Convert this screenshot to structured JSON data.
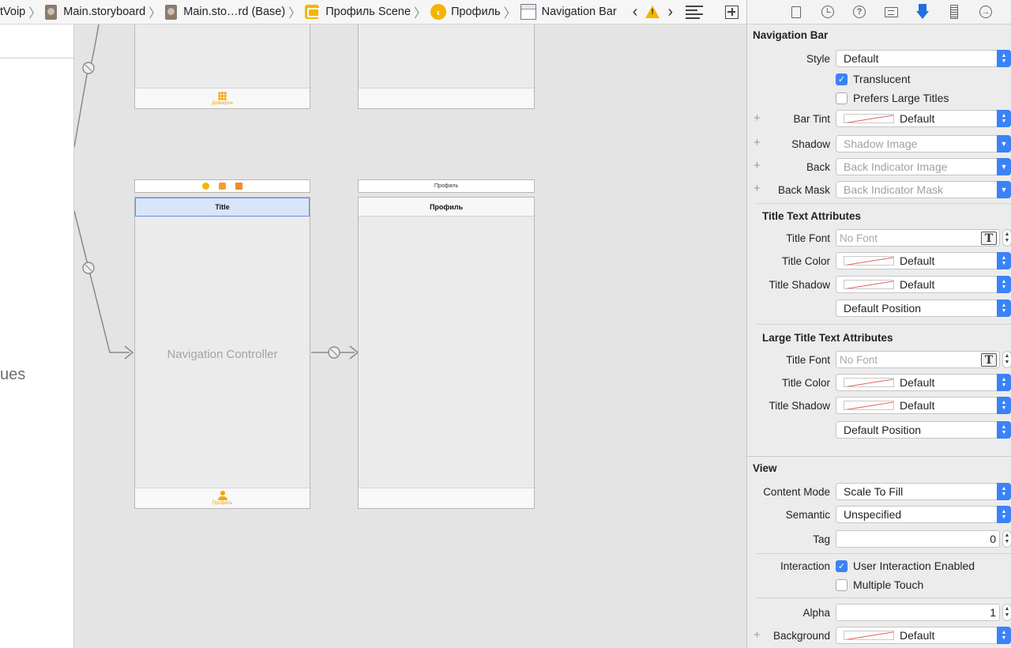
{
  "breadcrumbs": [
    "tVoip",
    "Main.storyboard",
    "Main.sto…rd (Base)",
    "Профиль Scene",
    "Профиль",
    "Navigation Bar"
  ],
  "outline": {
    "fragment": "ues"
  },
  "canvas": {
    "top_tab_label": "Домофон",
    "bottom_tab_label": "Профиль",
    "nav_title": "Title",
    "nav_controller_label": "Navigation Controller",
    "dock_title": "Профиль",
    "profile_nav_title": "Профиль"
  },
  "inspector": {
    "section_navbar": "Navigation Bar",
    "style_label": "Style",
    "style_value": "Default",
    "translucent_label": "Translucent",
    "translucent_checked": true,
    "large_titles_label": "Prefers Large Titles",
    "large_titles_checked": false,
    "bar_tint_label": "Bar Tint",
    "bar_tint_value": "Default",
    "shadow_label": "Shadow",
    "shadow_placeholder": "Shadow Image",
    "back_label": "Back",
    "back_placeholder": "Back Indicator Image",
    "back_mask_label": "Back Mask",
    "back_mask_placeholder": "Back Indicator Mask",
    "title_attrs_heading": "Title Text Attributes",
    "title_font_label": "Title Font",
    "title_font_placeholder": "No Font",
    "title_color_label": "Title Color",
    "title_color_value": "Default",
    "title_shadow_label": "Title Shadow",
    "title_shadow_value": "Default",
    "title_position_value": "Default Position",
    "large_attrs_heading": "Large Title Text Attributes",
    "large_font_label": "Title Font",
    "large_font_placeholder": "No Font",
    "large_color_label": "Title Color",
    "large_color_value": "Default",
    "large_shadow_label": "Title Shadow",
    "large_shadow_value": "Default",
    "large_position_value": "Default Position",
    "section_view": "View",
    "content_mode_label": "Content Mode",
    "content_mode_value": "Scale To Fill",
    "semantic_label": "Semantic",
    "semantic_value": "Unspecified",
    "tag_label": "Tag",
    "tag_value": "0",
    "interaction_label": "Interaction",
    "user_interaction_label": "User Interaction Enabled",
    "user_interaction_checked": true,
    "multiple_touch_label": "Multiple Touch",
    "multiple_touch_checked": false,
    "alpha_label": "Alpha",
    "alpha_value": "1",
    "background_label": "Background",
    "background_value": "Default",
    "font_icon_glyph": "T"
  },
  "colors": {
    "accent": "#3b82f6",
    "tab_tint": "#f5a500",
    "selection": "#d8e5fb"
  }
}
